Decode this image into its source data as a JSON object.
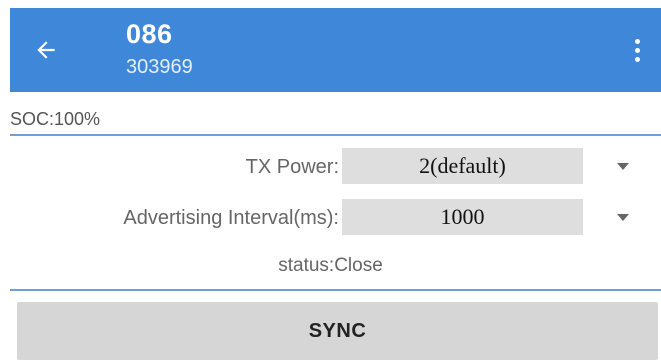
{
  "appbar": {
    "title": "086",
    "subtitle": "303969",
    "back_icon": "arrow-left-icon",
    "menu_icon": "more-vert-icon",
    "bg_color": "#3f87d8"
  },
  "soc": {
    "text": "SOC:100%"
  },
  "form": {
    "tx_power": {
      "label": "TX Power:",
      "value": "2(default)",
      "caret_icon": "dropdown-arrow-icon"
    },
    "advertising_interval": {
      "label": "Advertising Interval(ms):",
      "value": "1000",
      "caret_icon": "dropdown-arrow-icon"
    }
  },
  "status": {
    "text": "status:Close"
  },
  "actions": {
    "sync_label": "SYNC"
  },
  "colors": {
    "accent": "#3f87d8",
    "divider": "#6e9fd8",
    "field_bg": "#dedede",
    "button_bg": "#d6d6d6"
  }
}
